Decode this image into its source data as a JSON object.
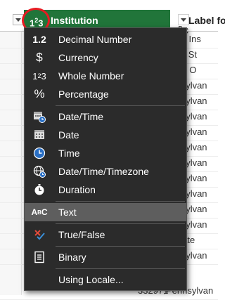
{
  "header": {
    "institution_column": {
      "type_icon": "1²3",
      "name": "Institution"
    },
    "label_column": {
      "type_icon": "ABC",
      "name": "Label fo"
    }
  },
  "table": {
    "label_cells": [
      "egon Ins",
      "tland St",
      "thern O",
      "ennsylvan",
      "ennsylvan",
      "ennsylvan",
      "ennsylvan",
      "ennsylvan",
      "ennsylvan",
      "ennsylvan",
      "ennsylvan",
      "ennsylvan",
      "ennsylvan",
      "n State",
      "ennsylvan"
    ],
    "last_row": {
      "number": "332971",
      "label": "Pennsylvan"
    }
  },
  "menu": {
    "items": [
      {
        "icon": "1.2",
        "label": "Decimal Number"
      },
      {
        "icon": "$",
        "label": "Currency"
      },
      {
        "icon": "1²3",
        "label": "Whole Number"
      },
      {
        "icon": "%",
        "label": "Percentage"
      },
      {
        "icon": "calendar-clock-icon",
        "label": "Date/Time"
      },
      {
        "icon": "calendar-icon",
        "label": "Date"
      },
      {
        "icon": "clock-icon",
        "label": "Time"
      },
      {
        "icon": "globe-clock-icon",
        "label": "Date/Time/Timezone"
      },
      {
        "icon": "stopwatch-icon",
        "label": "Duration"
      },
      {
        "icon": "ABC",
        "label": "Text",
        "selected": true
      },
      {
        "icon": "true-false-icon",
        "label": "True/False"
      },
      {
        "icon": "binary-icon",
        "label": "Binary"
      },
      {
        "icon": "",
        "label": "Using Locale..."
      }
    ]
  },
  "colors": {
    "header_active": "#21753a",
    "menu_bg": "#2b2b2b",
    "menu_selected": "#5e5e5e",
    "highlight": "#e81b22"
  }
}
